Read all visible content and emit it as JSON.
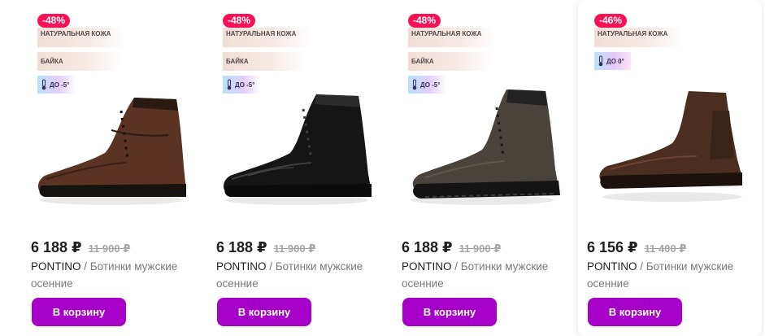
{
  "currency": "₽",
  "button_label": "В корзину",
  "products": [
    {
      "discount": "-48%",
      "material_tag": "НАТУРАЛЬНАЯ КОЖА",
      "lining_tag": "БАЙКА",
      "temp_tag": "ДО -5°",
      "price": "6 188 ₽",
      "old_price": "11 900 ₽",
      "brand": "PONTINO",
      "name": " / Ботинки мужские осенние",
      "shoe_color": "#5a3323"
    },
    {
      "discount": "-48%",
      "material_tag": "НАТУРАЛЬНАЯ КОЖА",
      "lining_tag": "БАЙКА",
      "temp_tag": "ДО -5°",
      "price": "6 188 ₽",
      "old_price": "11 900 ₽",
      "brand": "PONTINO",
      "name": " / Ботинки мужские осенние",
      "shoe_color": "#151515"
    },
    {
      "discount": "-48%",
      "material_tag": "НАТУРАЛЬНАЯ КОЖА",
      "lining_tag": "БАЙКА",
      "temp_tag": "ДО -5°",
      "price": "6 188 ₽",
      "old_price": "11 900 ₽",
      "brand": "PONTINO",
      "name": " / Ботинки мужские осенние",
      "shoe_color": "#4a433c"
    },
    {
      "discount": "-46%",
      "material_tag": "НАТУРАЛЬНАЯ КОЖА",
      "temp_tag": "ДО 0°",
      "price": "6 156 ₽",
      "old_price": "11 400 ₽",
      "brand": "PONTINO",
      "name": " / Ботинки мужские осенние",
      "shoe_color": "#4b2e20"
    }
  ]
}
